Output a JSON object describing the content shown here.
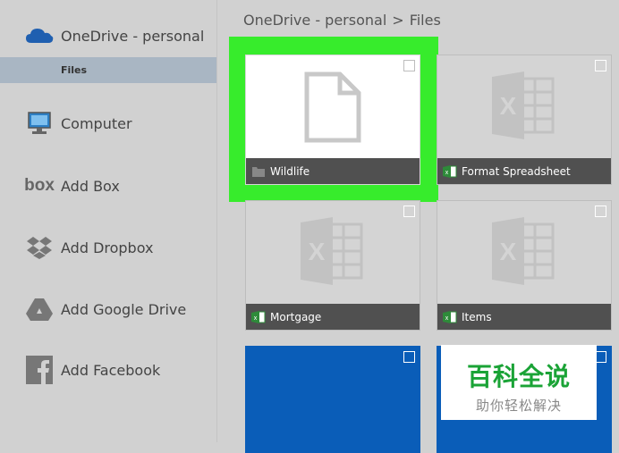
{
  "sidebar": {
    "header": {
      "label": "OneDrive - personal",
      "icon": "cloud-icon"
    },
    "sub_item": {
      "label": "Files"
    },
    "items": [
      {
        "label": "Computer",
        "icon": "computer-icon"
      },
      {
        "label": "Add Box",
        "icon": "box-logo-icon"
      },
      {
        "label": "Add Dropbox",
        "icon": "dropbox-icon"
      },
      {
        "label": "Add Google Drive",
        "icon": "google-drive-icon"
      },
      {
        "label": "Add Facebook",
        "icon": "facebook-icon"
      }
    ]
  },
  "breadcrumb": {
    "root": "OneDrive - personal",
    "separator": ">",
    "current": "Files"
  },
  "files": [
    {
      "name": "Wildlife",
      "type": "folder",
      "selected": true
    },
    {
      "name": "Format Spreadsheet",
      "type": "excel"
    },
    {
      "name": "Mortgage",
      "type": "excel"
    },
    {
      "name": "Items",
      "type": "excel"
    },
    {
      "name": "",
      "type": "blue"
    },
    {
      "name": "",
      "type": "blue"
    }
  ],
  "watermark": {
    "title": "百科全说",
    "subtitle": "助你轻松解决"
  },
  "colors": {
    "highlight": "#37ec2c",
    "sidebar_selected": "#a9b6c3",
    "tile_bar": "#505050",
    "blue_tile": "#0a5db8",
    "onedrive": "#1f5fb0"
  }
}
